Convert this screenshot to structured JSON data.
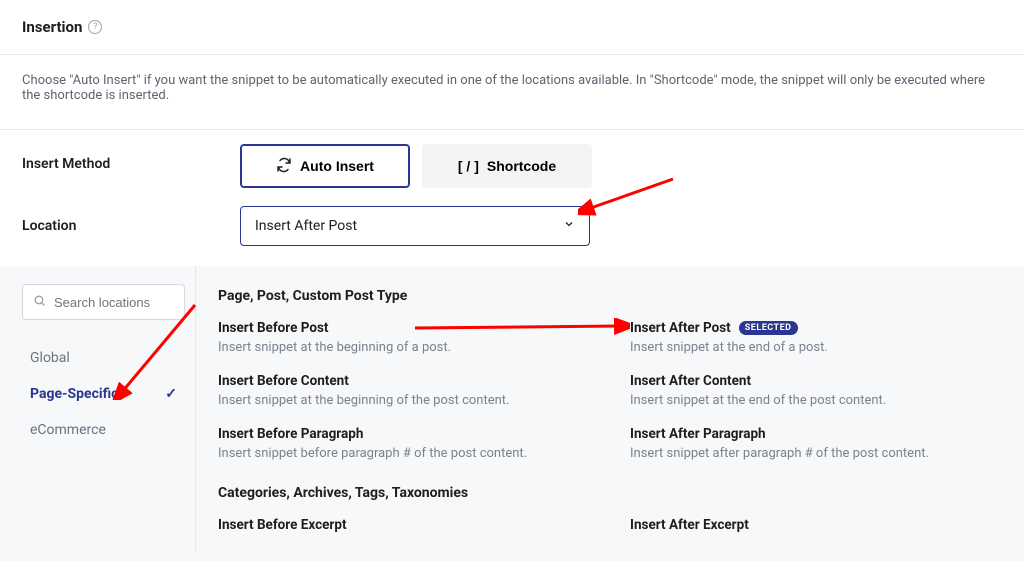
{
  "section": {
    "title": "Insertion"
  },
  "description": "Choose \"Auto Insert\" if you want the snippet to be automatically executed in one of the locations available. In \"Shortcode\" mode, the snippet will only be executed where the shortcode is inserted.",
  "rows": {
    "insert_method": {
      "label": "Insert Method"
    },
    "location": {
      "label": "Location"
    }
  },
  "methods": {
    "auto_insert": "Auto Insert",
    "shortcode": "Shortcode",
    "shortcode_symbol": "[ / ]"
  },
  "dropdown": {
    "value": "Insert After Post"
  },
  "sidebar": {
    "search_placeholder": "Search locations",
    "items": [
      {
        "label": "Global"
      },
      {
        "label": "Page-Specific"
      },
      {
        "label": "eCommerce"
      }
    ]
  },
  "panel": {
    "group1_title": "Page, Post, Custom Post Type",
    "group2_title": "Categories, Archives, Tags, Taxonomies",
    "selected_badge": "SELECTED",
    "options_left": [
      {
        "title": "Insert Before Post",
        "desc": "Insert snippet at the beginning of a post."
      },
      {
        "title": "Insert Before Content",
        "desc": "Insert snippet at the beginning of the post content."
      },
      {
        "title": "Insert Before Paragraph",
        "desc": "Insert snippet before paragraph # of the post content."
      }
    ],
    "options_right": [
      {
        "title": "Insert After Post",
        "desc": "Insert snippet at the end of a post.",
        "selected": true
      },
      {
        "title": "Insert After Content",
        "desc": "Insert snippet at the end of the post content."
      },
      {
        "title": "Insert After Paragraph",
        "desc": "Insert snippet after paragraph # of the post content."
      }
    ],
    "excerpt_left": {
      "title": "Insert Before Excerpt"
    },
    "excerpt_right": {
      "title": "Insert After Excerpt"
    }
  }
}
